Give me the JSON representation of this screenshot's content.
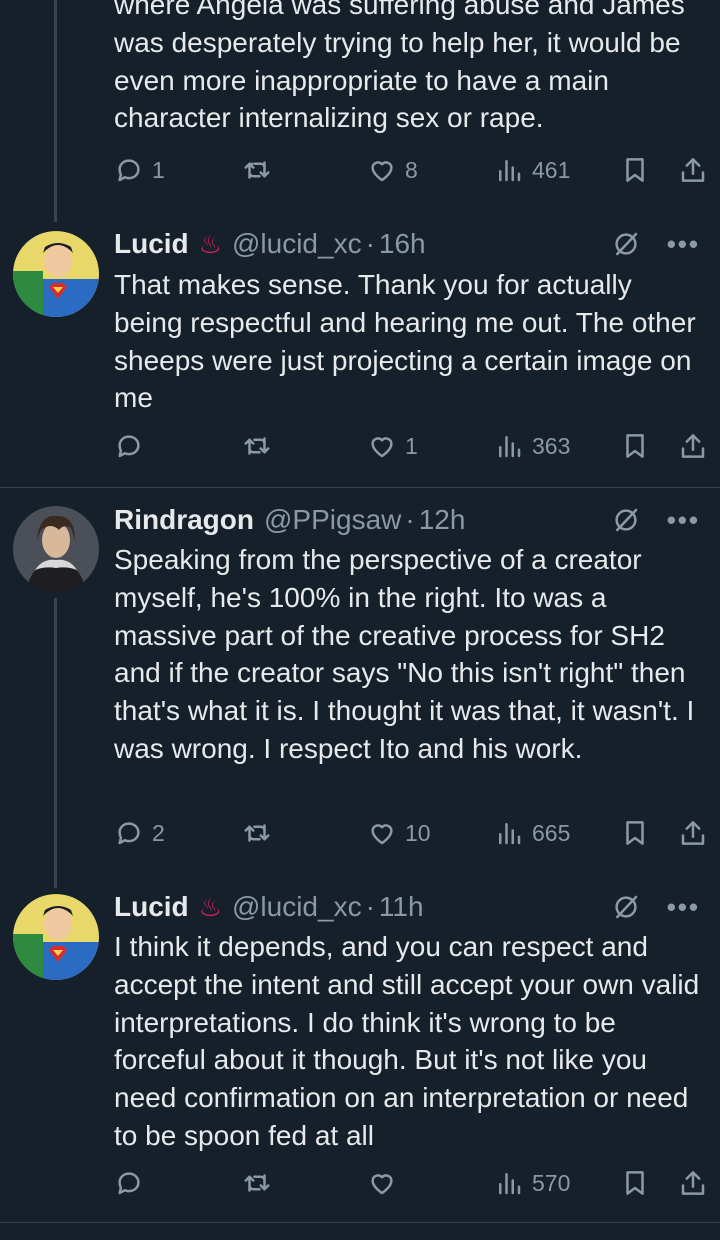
{
  "tweets": [
    {
      "body": "where Angela was suffering abuse and James was desperately trying to help her, it would be even more inappropriate to have a main character internalizing sex or rape.",
      "replies": "1",
      "retweets": "",
      "likes": "8",
      "views": "461"
    },
    {
      "name": "Lucid",
      "badge": "♨",
      "handle": "@lucid_xc",
      "time": "16h",
      "body": "That makes sense. Thank you for actually being respectful and hearing me out. The other sheeps were just projecting a certain image on me",
      "replies": "",
      "retweets": "",
      "likes": "1",
      "views": "363"
    },
    {
      "name": "Rindragon",
      "handle": "@PPigsaw",
      "time": "12h",
      "body": "Speaking from the perspective of a creator myself, he's 100% in the right. Ito was a massive part of the creative process for SH2 and if the creator says \"No this isn't right\" then that's what it is. I thought it was that, it wasn't. I was wrong. I respect Ito and his work.",
      "replies": "2",
      "retweets": "",
      "likes": "10",
      "views": "665"
    },
    {
      "name": "Lucid",
      "badge": "♨",
      "handle": "@lucid_xc",
      "time": "11h",
      "body": "I think it depends, and you can respect and accept the intent and still accept your own valid interpretations. I do think it's wrong to be forceful about it though. But it's not like you need confirmation on an interpretation or need to be spoon fed at all",
      "replies": "",
      "retweets": "",
      "likes": "",
      "views": "570"
    }
  ],
  "separator_dot": "·",
  "more_glyph": "•••",
  "icons": [
    "reply-icon",
    "retweet-icon",
    "like-icon",
    "views-icon",
    "bookmark-icon",
    "share-icon",
    "grok-icon",
    "more-icon"
  ],
  "colors": {
    "background": "#15202b",
    "text": "#e7e9ea",
    "muted": "#8b98a5",
    "border": "#38444d",
    "badge": "#e0245e"
  }
}
